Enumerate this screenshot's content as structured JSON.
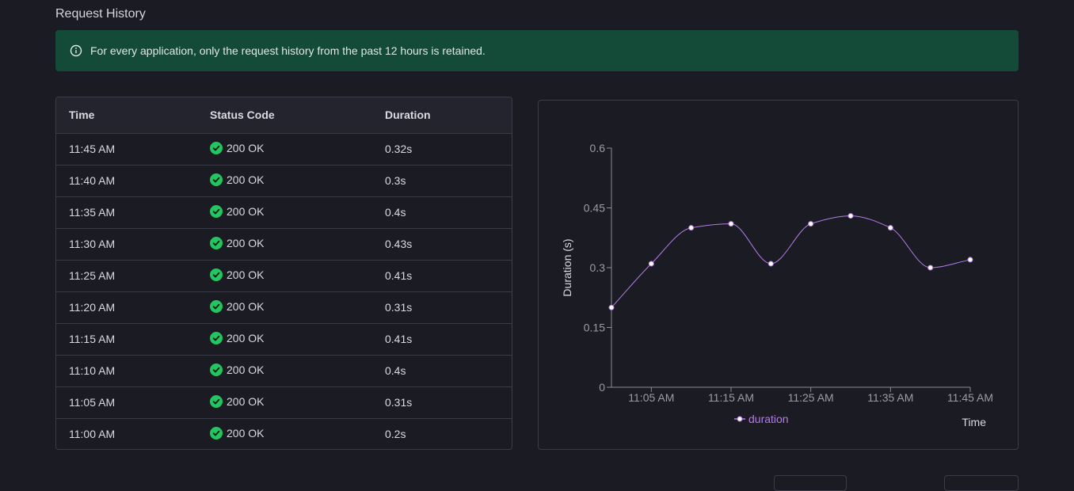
{
  "page": {
    "title": "Request History"
  },
  "notice": {
    "text": "For every application, only the request history from the past 12 hours is retained.",
    "icon": "info-icon",
    "bg_color": "#134a38"
  },
  "table": {
    "headers": [
      "Time",
      "Status Code",
      "Duration"
    ],
    "rows": [
      {
        "time": "11:45 AM",
        "status": "200 OK",
        "duration": "0.32s"
      },
      {
        "time": "11:40 AM",
        "status": "200 OK",
        "duration": "0.3s"
      },
      {
        "time": "11:35 AM",
        "status": "200 OK",
        "duration": "0.4s"
      },
      {
        "time": "11:30 AM",
        "status": "200 OK",
        "duration": "0.43s"
      },
      {
        "time": "11:25 AM",
        "status": "200 OK",
        "duration": "0.41s"
      },
      {
        "time": "11:20 AM",
        "status": "200 OK",
        "duration": "0.31s"
      },
      {
        "time": "11:15 AM",
        "status": "200 OK",
        "duration": "0.41s"
      },
      {
        "time": "11:10 AM",
        "status": "200 OK",
        "duration": "0.4s"
      },
      {
        "time": "11:05 AM",
        "status": "200 OK",
        "duration": "0.31s"
      },
      {
        "time": "11:00 AM",
        "status": "200 OK",
        "duration": "0.2s"
      }
    ],
    "status_icon": "check-circle-icon",
    "status_color": "#22c55e"
  },
  "chart_data": {
    "type": "line",
    "x": [
      "11:00 AM",
      "11:05 AM",
      "11:10 AM",
      "11:15 AM",
      "11:20 AM",
      "11:25 AM",
      "11:30 AM",
      "11:35 AM",
      "11:40 AM",
      "11:45 AM"
    ],
    "x_tick_labels": [
      "11:05 AM",
      "11:15 AM",
      "11:25 AM",
      "11:35 AM",
      "11:45 AM"
    ],
    "series": [
      {
        "name": "duration",
        "values": [
          0.2,
          0.31,
          0.4,
          0.41,
          0.31,
          0.41,
          0.43,
          0.4,
          0.3,
          0.32
        ],
        "color": "#b57ce6"
      }
    ],
    "ylabel": "Duration (s)",
    "xlabel": "Time",
    "ylim": [
      0,
      0.6
    ],
    "y_ticks": [
      "0",
      "0.15",
      "0.3",
      "0.45",
      "0.6"
    ],
    "grid": false,
    "legend": "bottom",
    "smooth": true
  }
}
